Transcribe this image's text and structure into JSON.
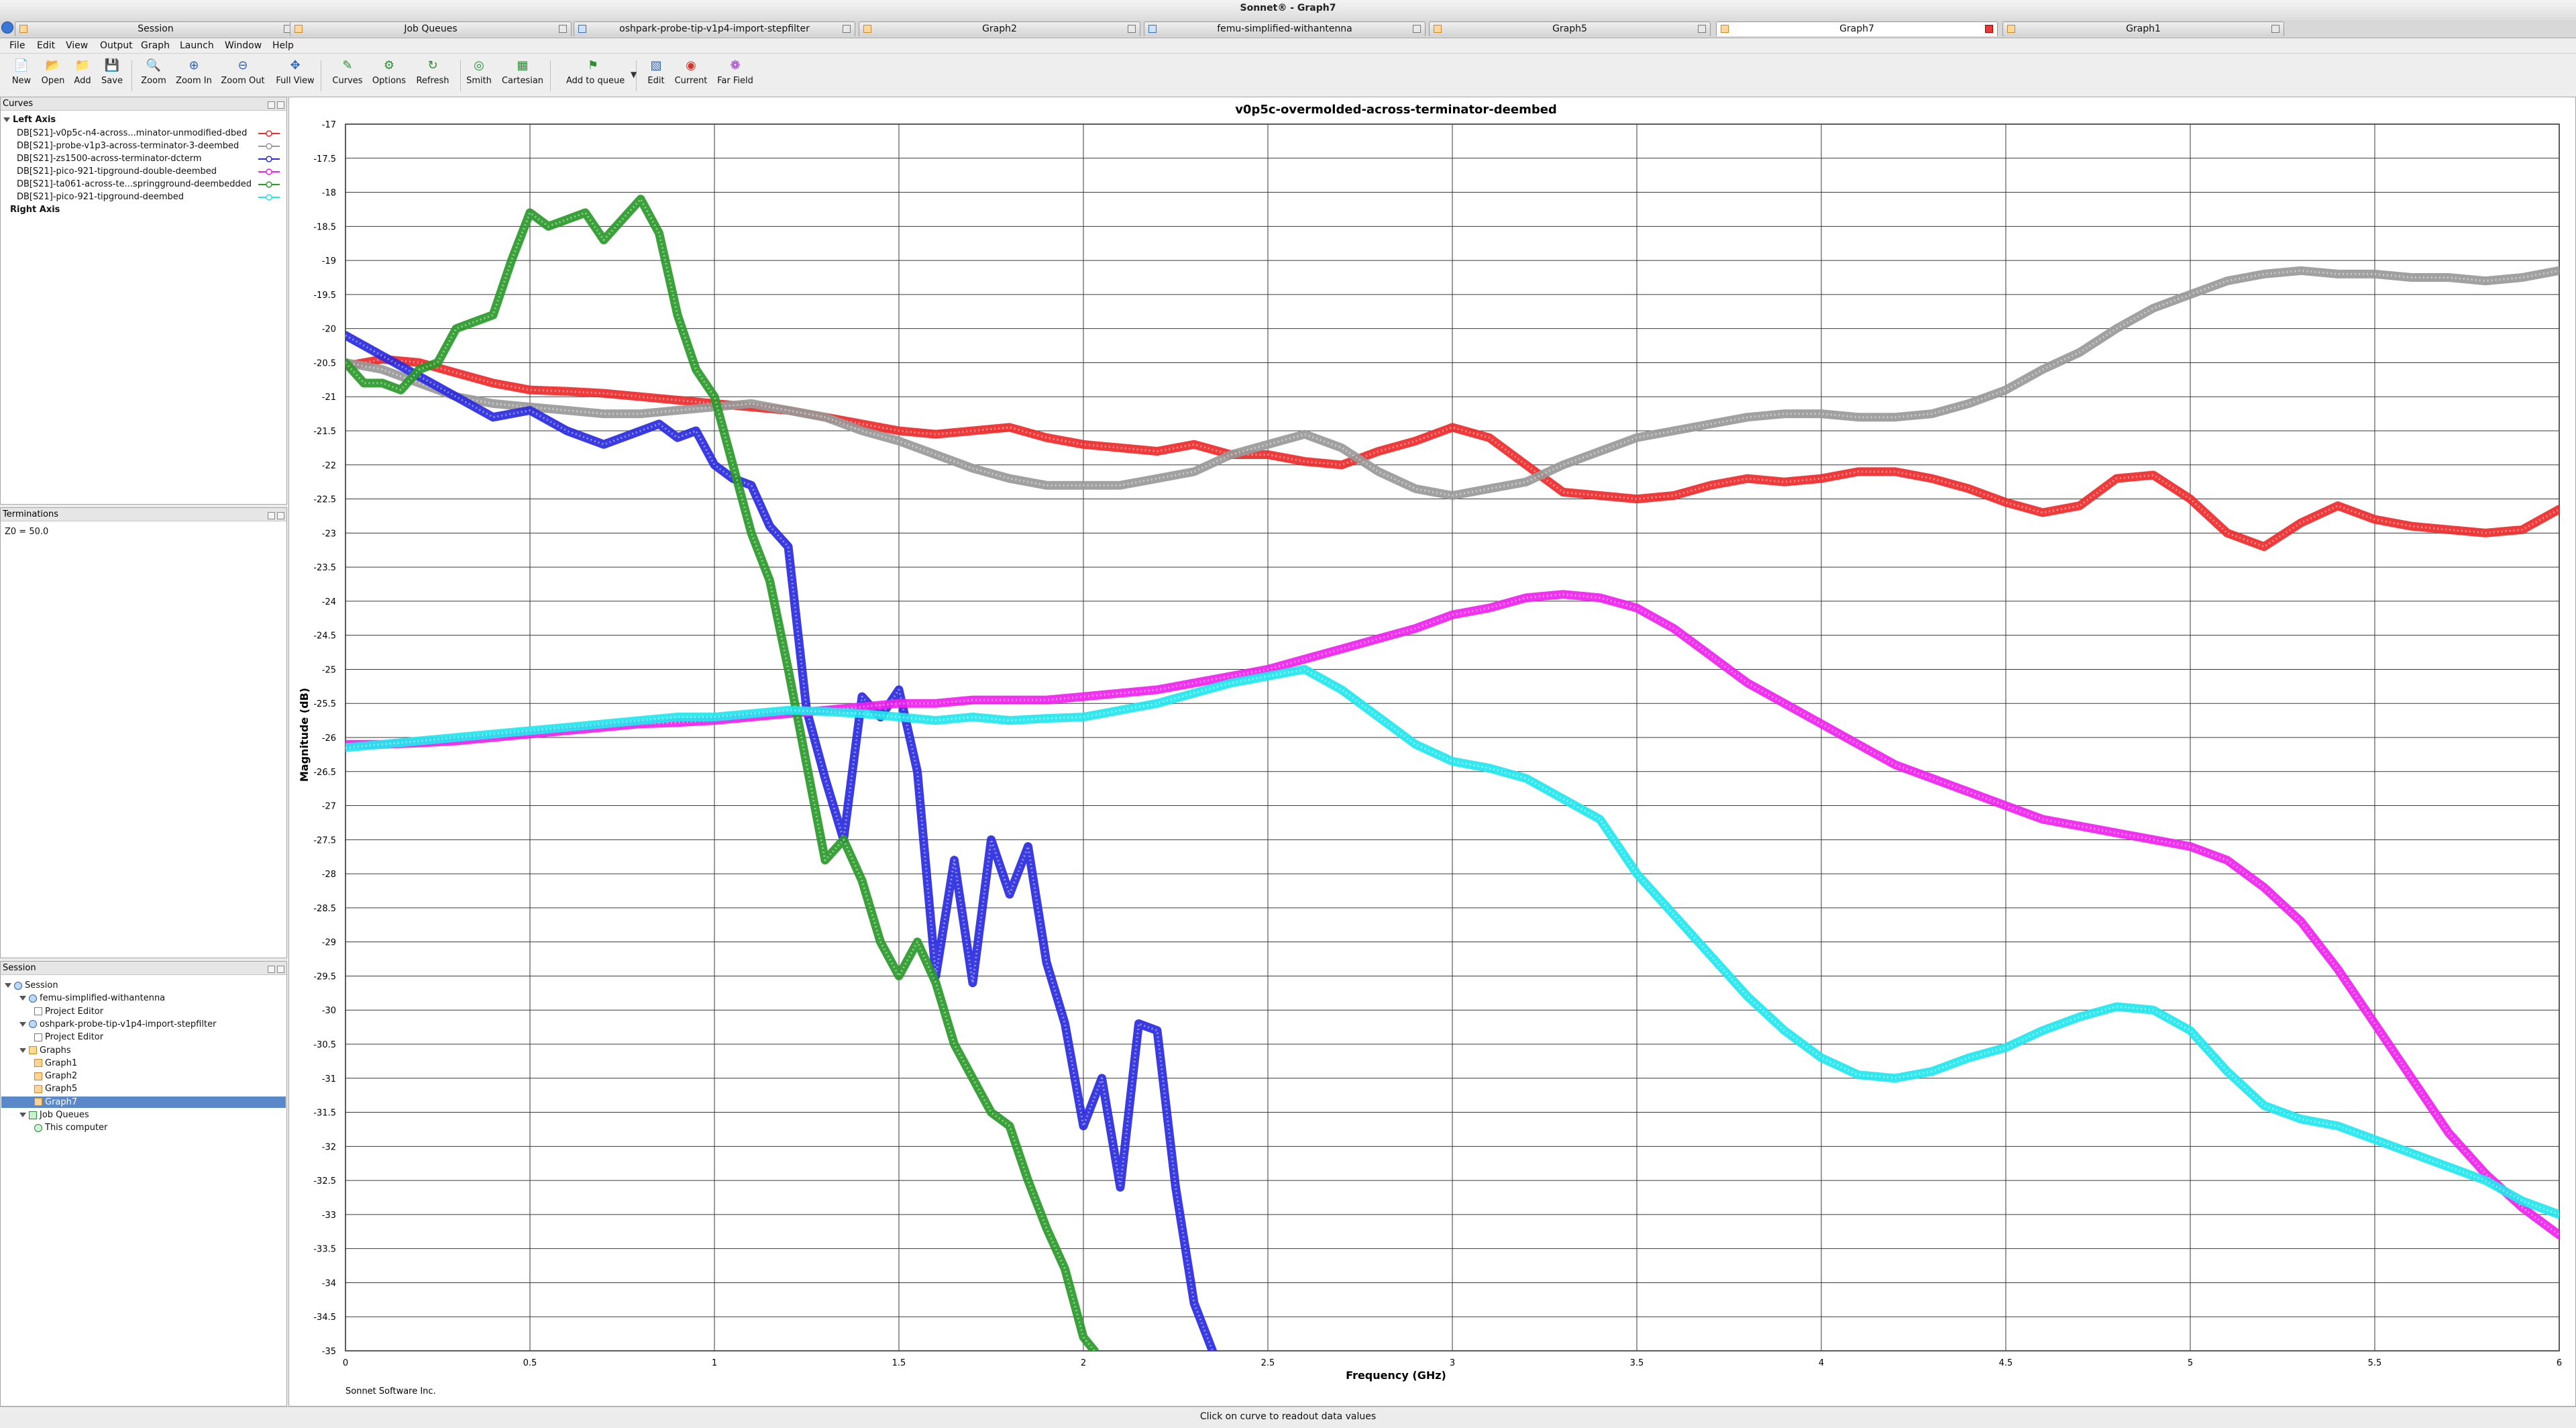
{
  "window": {
    "title": "Sonnet® - Graph7"
  },
  "tabs": [
    {
      "label": "Session",
      "icon": "session-icon",
      "active": false
    },
    {
      "label": "Job Queues",
      "icon": "job-queue-icon",
      "active": false
    },
    {
      "label": "oshpark-probe-tip-v1p4-import-stepfilter",
      "icon": "project-icon",
      "active": false
    },
    {
      "label": "Graph2",
      "icon": "graph-icon",
      "active": false
    },
    {
      "label": "femu-simplified-withantenna",
      "icon": "project-icon",
      "active": false
    },
    {
      "label": "Graph5",
      "icon": "graph-icon",
      "active": false
    },
    {
      "label": "Graph7",
      "icon": "graph-icon",
      "active": true
    },
    {
      "label": "Graph1",
      "icon": "graph-icon",
      "active": false
    }
  ],
  "menu": [
    "File",
    "Edit",
    "View",
    "Output",
    "Graph",
    "Launch",
    "Window",
    "Help"
  ],
  "toolbar": [
    {
      "label": "New",
      "icon": "new-file-icon"
    },
    {
      "label": "Open",
      "icon": "open-folder-icon"
    },
    {
      "label": "Add",
      "icon": "add-folder-icon"
    },
    {
      "label": "Save",
      "icon": "save-icon"
    },
    {
      "label": "Zoom",
      "icon": "zoom-icon"
    },
    {
      "label": "Zoom In",
      "icon": "zoom-in-icon"
    },
    {
      "label": "Zoom Out",
      "icon": "zoom-out-icon"
    },
    {
      "label": "Full View",
      "icon": "full-view-icon"
    },
    {
      "label": "Curves",
      "icon": "curves-icon"
    },
    {
      "label": "Options",
      "icon": "options-icon"
    },
    {
      "label": "Refresh",
      "icon": "refresh-icon"
    },
    {
      "label": "Smith",
      "icon": "smith-chart-icon"
    },
    {
      "label": "Cartesian",
      "icon": "cartesian-grid-icon"
    },
    {
      "label": "Add to queue",
      "icon": "add-to-queue-icon"
    },
    {
      "label": "Edit",
      "icon": "edit-icon"
    },
    {
      "label": "Current",
      "icon": "current-icon"
    },
    {
      "label": "Far Field",
      "icon": "far-field-icon"
    }
  ],
  "curves_panel": {
    "title": "Curves",
    "left_axis_label": "Left Axis",
    "right_axis_label": "Right Axis",
    "items": [
      {
        "label": "DB[S21]-v0p5c-n4-across...minator-unmodified-dbed",
        "color": "#ee2a2a"
      },
      {
        "label": "DB[S21]-probe-v1p3-across-terminator-3-deembed",
        "color": "#999999"
      },
      {
        "label": "DB[S21]-zs1500-across-terminator-dcterm",
        "color": "#2a2ae0"
      },
      {
        "label": "DB[S21]-pico-921-tipground-double-deembed",
        "color": "#ee22ee"
      },
      {
        "label": "DB[S21]-ta061-across-te...springground-deembedded",
        "color": "#2a9a2a"
      },
      {
        "label": "DB[S21]-pico-921-tipground-deembed",
        "color": "#22e6ee"
      }
    ]
  },
  "terminations_panel": {
    "title": "Terminations",
    "text": "Z0 = 50.0"
  },
  "session_panel": {
    "title": "Session",
    "tree": [
      {
        "label": "Session",
        "level": 0,
        "icon": "session",
        "expanded": true
      },
      {
        "label": "femu-simplified-withantenna",
        "level": 1,
        "icon": "proj",
        "expanded": true
      },
      {
        "label": "Project Editor",
        "level": 2,
        "icon": "doc"
      },
      {
        "label": "oshpark-probe-tip-v1p4-import-stepfilter",
        "level": 1,
        "icon": "proj",
        "expanded": true
      },
      {
        "label": "Project Editor",
        "level": 2,
        "icon": "doc"
      },
      {
        "label": "Graphs",
        "level": 1,
        "icon": "folder",
        "expanded": true
      },
      {
        "label": "Graph1",
        "level": 2,
        "icon": "graph"
      },
      {
        "label": "Graph2",
        "level": 2,
        "icon": "graph"
      },
      {
        "label": "Graph5",
        "level": 2,
        "icon": "graph"
      },
      {
        "label": "Graph7",
        "level": 2,
        "icon": "graph",
        "selected": true
      },
      {
        "label": "Job Queues",
        "level": 1,
        "icon": "job",
        "expanded": true
      },
      {
        "label": "This computer",
        "level": 2,
        "icon": "check"
      }
    ]
  },
  "status": "Click on curve to readout data values",
  "footer_text": "Sonnet Software Inc.",
  "chart_data": {
    "type": "line",
    "title": "v0p5c-overmolded-across-terminator-deembed",
    "xlabel": "Frequency (GHz)",
    "ylabel": "Magnitude (dB)",
    "xlim": [
      0,
      6
    ],
    "ylim": [
      -35,
      -17
    ],
    "xticks": [
      0,
      0.5,
      1,
      1.5,
      2,
      2.5,
      3,
      3.5,
      4,
      4.5,
      5,
      5.5,
      6
    ],
    "xtick_labels": [
      "0",
      "0.5",
      "1",
      "1.5",
      "2",
      "2.5",
      "3",
      "3.5",
      "4",
      "4.5",
      "5",
      "5.5",
      "6"
    ],
    "yticks": [
      -17,
      -17.5,
      -18,
      -18.5,
      -19,
      -19.5,
      -20,
      -20.5,
      -21,
      -21.5,
      -22,
      -22.5,
      -23,
      -23.5,
      -24,
      -24.5,
      -25,
      -25.5,
      -26,
      -26.5,
      -27,
      -27.5,
      -28,
      -28.5,
      -29,
      -29.5,
      -30,
      -30.5,
      -31,
      -31.5,
      -32,
      -32.5,
      -33,
      -33.5,
      -34,
      -34.5,
      -35
    ],
    "ytick_labels": [
      "-17",
      "-17.5",
      "-18",
      "-18.5",
      "-19",
      "-19.5",
      "-20",
      "-20.5",
      "-21",
      "-21.5",
      "-22",
      "-22.5",
      "-23",
      "-23.5",
      "-24",
      "-24.5",
      "-25",
      "-25.5",
      "-26",
      "-26.5",
      "-27",
      "-27.5",
      "-28",
      "-28.5",
      "-29",
      "-29.5",
      "-30",
      "-30.5",
      "-31",
      "-31.5",
      "-32",
      "-32.5",
      "-33",
      "-33.5",
      "-34",
      "-34.5",
      "-35"
    ],
    "grid": true,
    "series": [
      {
        "color": "#ee2a2a",
        "x": [
          0,
          0.1,
          0.2,
          0.3,
          0.4,
          0.5,
          0.6,
          0.7,
          0.8,
          0.9,
          1.0,
          1.1,
          1.2,
          1.3,
          1.4,
          1.5,
          1.6,
          1.7,
          1.8,
          1.9,
          2.0,
          2.1,
          2.2,
          2.3,
          2.4,
          2.5,
          2.6,
          2.7,
          2.8,
          2.9,
          3.0,
          3.1,
          3.2,
          3.3,
          3.4,
          3.5,
          3.6,
          3.7,
          3.8,
          3.9,
          4.0,
          4.1,
          4.2,
          4.3,
          4.4,
          4.5,
          4.6,
          4.7,
          4.8,
          4.9,
          5.0,
          5.1,
          5.2,
          5.3,
          5.4,
          5.5,
          5.6,
          5.7,
          5.8,
          5.9,
          6.0
        ],
        "y": [
          -20.55,
          -20.45,
          -20.5,
          -20.65,
          -20.8,
          -20.9,
          -20.92,
          -20.95,
          -21.0,
          -21.05,
          -21.1,
          -21.15,
          -21.2,
          -21.3,
          -21.4,
          -21.5,
          -21.55,
          -21.5,
          -21.45,
          -21.6,
          -21.7,
          -21.75,
          -21.8,
          -21.7,
          -21.85,
          -21.85,
          -21.95,
          -22.0,
          -21.8,
          -21.65,
          -21.45,
          -21.6,
          -22.0,
          -22.4,
          -22.45,
          -22.5,
          -22.45,
          -22.3,
          -22.2,
          -22.25,
          -22.2,
          -22.1,
          -22.1,
          -22.2,
          -22.35,
          -22.55,
          -22.7,
          -22.6,
          -22.2,
          -22.15,
          -22.5,
          -23.0,
          -23.2,
          -22.85,
          -22.6,
          -22.8,
          -22.9,
          -22.95,
          -23.0,
          -22.95,
          -22.65
        ]
      },
      {
        "color": "#999999",
        "x": [
          0,
          0.1,
          0.2,
          0.3,
          0.4,
          0.5,
          0.6,
          0.7,
          0.8,
          0.9,
          1.0,
          1.1,
          1.2,
          1.3,
          1.4,
          1.5,
          1.6,
          1.7,
          1.8,
          1.9,
          2.0,
          2.1,
          2.2,
          2.3,
          2.4,
          2.5,
          2.6,
          2.7,
          2.8,
          2.9,
          3.0,
          3.1,
          3.2,
          3.3,
          3.4,
          3.5,
          3.6,
          3.7,
          3.8,
          3.9,
          4.0,
          4.1,
          4.2,
          4.3,
          4.4,
          4.5,
          4.6,
          4.7,
          4.8,
          4.9,
          5.0,
          5.1,
          5.2,
          5.3,
          5.4,
          5.5,
          5.6,
          5.7,
          5.8,
          5.9,
          6.0
        ],
        "y": [
          -20.5,
          -20.6,
          -20.8,
          -21.0,
          -21.1,
          -21.15,
          -21.2,
          -21.25,
          -21.25,
          -21.2,
          -21.15,
          -21.1,
          -21.2,
          -21.3,
          -21.5,
          -21.65,
          -21.85,
          -22.05,
          -22.2,
          -22.3,
          -22.3,
          -22.3,
          -22.2,
          -22.1,
          -21.85,
          -21.7,
          -21.55,
          -21.75,
          -22.1,
          -22.35,
          -22.45,
          -22.35,
          -22.25,
          -22.0,
          -21.8,
          -21.6,
          -21.5,
          -21.4,
          -21.3,
          -21.25,
          -21.25,
          -21.3,
          -21.3,
          -21.25,
          -21.1,
          -20.9,
          -20.6,
          -20.35,
          -20.0,
          -19.7,
          -19.5,
          -19.3,
          -19.2,
          -19.15,
          -19.2,
          -19.2,
          -19.25,
          -19.25,
          -19.3,
          -19.25,
          -19.15
        ]
      },
      {
        "color": "#2a2ae0",
        "x": [
          0,
          0.1,
          0.2,
          0.3,
          0.4,
          0.5,
          0.6,
          0.7,
          0.8,
          0.85,
          0.9,
          0.95,
          1.0,
          1.05,
          1.1,
          1.15,
          1.2,
          1.25,
          1.3,
          1.35,
          1.4,
          1.45,
          1.5,
          1.55,
          1.6,
          1.65,
          1.7,
          1.75,
          1.8,
          1.85,
          1.9,
          1.95,
          2.0,
          2.05,
          2.1,
          2.15,
          2.2,
          2.25,
          2.3,
          2.35
        ],
        "y": [
          -20.1,
          -20.4,
          -20.7,
          -21.0,
          -21.3,
          -21.2,
          -21.5,
          -21.7,
          -21.5,
          -21.4,
          -21.6,
          -21.5,
          -22.0,
          -22.2,
          -22.3,
          -22.9,
          -23.2,
          -25.6,
          -26.6,
          -27.5,
          -25.4,
          -25.7,
          -25.3,
          -26.5,
          -29.5,
          -27.8,
          -29.6,
          -27.5,
          -28.3,
          -27.6,
          -29.3,
          -30.2,
          -31.7,
          -31.0,
          -32.6,
          -30.2,
          -30.3,
          -32.6,
          -34.3,
          -35.0
        ]
      },
      {
        "color": "#ee22ee",
        "x": [
          0,
          0.1,
          0.2,
          0.3,
          0.4,
          0.5,
          0.6,
          0.7,
          0.8,
          0.9,
          1.0,
          1.1,
          1.2,
          1.3,
          1.4,
          1.5,
          1.6,
          1.7,
          1.8,
          1.9,
          2.0,
          2.1,
          2.2,
          2.3,
          2.4,
          2.5,
          2.6,
          2.7,
          2.8,
          2.9,
          3.0,
          3.1,
          3.2,
          3.3,
          3.4,
          3.5,
          3.6,
          3.7,
          3.8,
          3.9,
          4.0,
          4.1,
          4.2,
          4.3,
          4.4,
          4.5,
          4.6,
          4.7,
          4.8,
          4.9,
          5.0,
          5.1,
          5.2,
          5.3,
          5.4,
          5.5,
          5.6,
          5.7,
          5.8,
          5.9,
          6.0
        ],
        "y": [
          -26.1,
          -26.1,
          -26.08,
          -26.05,
          -26.0,
          -25.95,
          -25.9,
          -25.85,
          -25.8,
          -25.78,
          -25.75,
          -25.7,
          -25.65,
          -25.6,
          -25.55,
          -25.5,
          -25.5,
          -25.45,
          -25.45,
          -25.45,
          -25.4,
          -25.35,
          -25.3,
          -25.2,
          -25.1,
          -25.0,
          -24.85,
          -24.7,
          -24.55,
          -24.4,
          -24.2,
          -24.1,
          -23.95,
          -23.9,
          -23.95,
          -24.1,
          -24.4,
          -24.8,
          -25.2,
          -25.5,
          -25.8,
          -26.1,
          -26.4,
          -26.6,
          -26.8,
          -27.0,
          -27.2,
          -27.3,
          -27.4,
          -27.5,
          -27.6,
          -27.8,
          -28.2,
          -28.7,
          -29.4,
          -30.2,
          -31.0,
          -31.8,
          -32.4,
          -32.9,
          -33.3
        ]
      },
      {
        "color": "#2a9a2a",
        "x": [
          0,
          0.05,
          0.1,
          0.15,
          0.2,
          0.25,
          0.3,
          0.35,
          0.4,
          0.45,
          0.5,
          0.55,
          0.6,
          0.65,
          0.7,
          0.75,
          0.8,
          0.85,
          0.9,
          0.95,
          1.0,
          1.05,
          1.1,
          1.15,
          1.2,
          1.25,
          1.3,
          1.35,
          1.4,
          1.45,
          1.5,
          1.55,
          1.6,
          1.65,
          1.7,
          1.75,
          1.8,
          1.85,
          1.9,
          1.95,
          2.0,
          2.03
        ],
        "y": [
          -20.5,
          -20.8,
          -20.8,
          -20.9,
          -20.6,
          -20.5,
          -20.0,
          -19.9,
          -19.8,
          -19.0,
          -18.3,
          -18.5,
          -18.4,
          -18.3,
          -18.7,
          -18.4,
          -18.1,
          -18.6,
          -19.8,
          -20.6,
          -21.0,
          -22.0,
          -23.0,
          -23.7,
          -25.0,
          -26.4,
          -27.8,
          -27.5,
          -28.1,
          -29.0,
          -29.5,
          -29.0,
          -29.6,
          -30.5,
          -31.0,
          -31.5,
          -31.7,
          -32.5,
          -33.2,
          -33.8,
          -34.8,
          -35.0
        ]
      },
      {
        "color": "#22e6ee",
        "x": [
          0,
          0.1,
          0.2,
          0.3,
          0.4,
          0.5,
          0.6,
          0.7,
          0.8,
          0.9,
          1.0,
          1.1,
          1.2,
          1.3,
          1.4,
          1.5,
          1.6,
          1.7,
          1.8,
          1.9,
          2.0,
          2.1,
          2.2,
          2.3,
          2.4,
          2.5,
          2.6,
          2.7,
          2.8,
          2.9,
          3.0,
          3.1,
          3.2,
          3.3,
          3.4,
          3.5,
          3.6,
          3.7,
          3.8,
          3.9,
          4.0,
          4.1,
          4.2,
          4.3,
          4.4,
          4.5,
          4.6,
          4.7,
          4.8,
          4.9,
          5.0,
          5.1,
          5.2,
          5.3,
          5.4,
          5.5,
          5.6,
          5.7,
          5.8,
          5.9,
          6.0
        ],
        "y": [
          -26.15,
          -26.1,
          -26.05,
          -26.0,
          -25.95,
          -25.9,
          -25.85,
          -25.8,
          -25.75,
          -25.7,
          -25.7,
          -25.65,
          -25.6,
          -25.62,
          -25.65,
          -25.7,
          -25.75,
          -25.7,
          -25.75,
          -25.72,
          -25.7,
          -25.6,
          -25.5,
          -25.35,
          -25.2,
          -25.1,
          -25.0,
          -25.3,
          -25.7,
          -26.1,
          -26.35,
          -26.45,
          -26.6,
          -26.9,
          -27.2,
          -28.0,
          -28.6,
          -29.2,
          -29.8,
          -30.3,
          -30.7,
          -30.95,
          -31.0,
          -30.9,
          -30.7,
          -30.55,
          -30.3,
          -30.1,
          -29.95,
          -30.0,
          -30.3,
          -30.9,
          -31.4,
          -31.6,
          -31.7,
          -31.9,
          -32.1,
          -32.3,
          -32.5,
          -32.8,
          -33.0
        ]
      }
    ]
  }
}
